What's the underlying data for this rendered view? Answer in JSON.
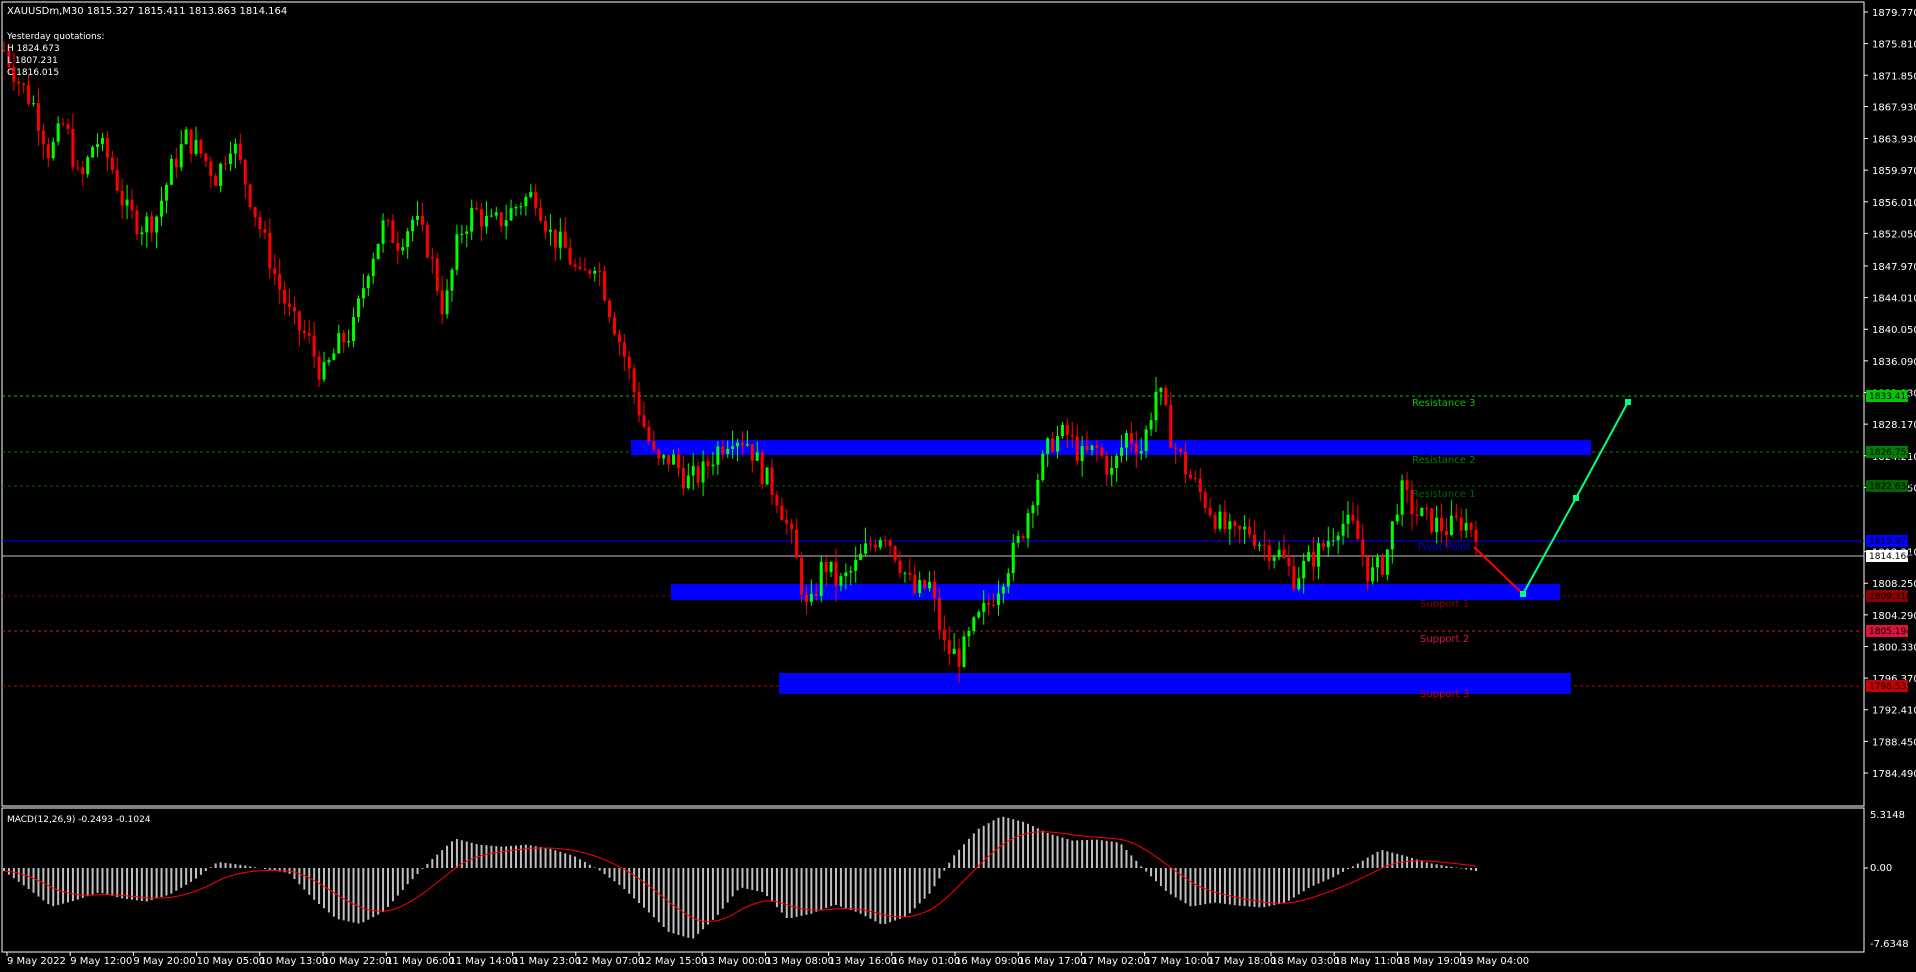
{
  "header": {
    "symbol_line": "XAUUSDm,M30  1815.327 1815.411 1813.863 1814.164",
    "yesterday_title": "Yesterday quotations:",
    "yesterday_high": "H 1824.673",
    "yesterday_low": "L 1807.231",
    "yesterday_close": "C 1816.015"
  },
  "macd": {
    "label": "MACD(12,26,9) -0.2493 -0.1024",
    "axis_top": "5.3148",
    "axis_zero": "0.00",
    "axis_bottom": "-7.6348"
  },
  "price_axis": {
    "ticks": [
      "1879.770",
      "1875.810",
      "1871.850",
      "1867.930",
      "1863.930",
      "1859.970",
      "1856.010",
      "1852.050",
      "1847.970",
      "1844.010",
      "1840.050",
      "1836.090",
      "1832.130",
      "1828.170",
      "1824.210",
      "1820.250",
      "1812.210",
      "1808.250",
      "1804.290",
      "1800.330",
      "1796.370",
      "1792.410",
      "1788.450",
      "1784.490"
    ]
  },
  "time_axis": {
    "labels": [
      "9 May 2022",
      "9 May 12:00",
      "9 May 20:00",
      "10 May 05:00",
      "10 May 13:00",
      "10 May 22:00",
      "11 May 06:00",
      "11 May 14:00",
      "11 May 23:00",
      "12 May 07:00",
      "12 May 15:00",
      "13 May 00:00",
      "13 May 08:00",
      "13 May 16:00",
      "16 May 01:00",
      "16 May 09:00",
      "16 May 17:00",
      "17 May 02:00",
      "17 May 10:00",
      "17 May 18:00",
      "18 May 03:00",
      "18 May 11:00",
      "18 May 19:00",
      "19 May 04:00"
    ]
  },
  "levels": {
    "resistance_3": {
      "label": "Resistance 3",
      "price": "1833.415",
      "color": "#00c800"
    },
    "resistance_2": {
      "label": "Resistance 2",
      "price": "1826.752",
      "color": "#008000"
    },
    "resistance_1": {
      "label": "Resistance 1",
      "price": "1822.636",
      "color": "#006400"
    },
    "pivot": {
      "label": "Pivot Point",
      "price": "1815.973",
      "color": "#0000ff"
    },
    "current": {
      "price": "1814.164"
    },
    "support_1": {
      "label": "Support 1",
      "price": "1809.310",
      "color": "#8b0000"
    },
    "support_2": {
      "label": "Support 2",
      "price": "1805.194",
      "color": "#dc143c"
    },
    "support_3": {
      "label": "Support 3",
      "price": "1798.531",
      "color": "#c80000"
    }
  },
  "colors": {
    "background": "#000000",
    "bull": "#00ff00",
    "bear": "#ff0000",
    "zone": "#0000ff",
    "projection_down": "#ff0000",
    "projection_up": "#00ff7f",
    "macd_hist": "#c0c0c0",
    "macd_signal": "#ff0000"
  },
  "chart_data": {
    "type": "candlestick",
    "symbol": "XAUUSDm",
    "timeframe": "M30",
    "close_path": [
      1875,
      1871,
      1868,
      1862,
      1866,
      1858,
      1864,
      1861,
      1855,
      1853,
      1854,
      1860,
      1864,
      1862,
      1859,
      1864,
      1858,
      1852,
      1846,
      1841,
      1839,
      1834,
      1838,
      1840,
      1848,
      1853,
      1851,
      1854,
      1850,
      1842,
      1852,
      1855,
      1853,
      1854,
      1856,
      1857,
      1852,
      1850,
      1846,
      1849,
      1842,
      1836,
      1829,
      1823,
      1824,
      1821,
      1822,
      1825,
      1827,
      1826,
      1822,
      1819,
      1813,
      1804,
      1811,
      1808,
      1810,
      1813,
      1815,
      1811,
      1807,
      1808,
      1800,
      1799,
      1803,
      1806,
      1810,
      1814,
      1821,
      1826,
      1827,
      1824,
      1825,
      1822,
      1827,
      1825,
      1833,
      1826,
      1822,
      1819,
      1816,
      1814,
      1815,
      1813,
      1812,
      1809,
      1811,
      1813,
      1816,
      1815,
      1809,
      1811,
      1820,
      1817,
      1816,
      1815,
      1816,
      1815
    ],
    "macd_hist_path": [
      -0.3,
      -2.0,
      -3.8,
      -3.2,
      -2.4,
      -3.0,
      -3.3,
      -2.6,
      -1.2,
      0.6,
      0.3,
      -0.1,
      -0.5,
      -3.0,
      -5.0,
      -5.5,
      -4.3,
      -1.6,
      0.8,
      2.9,
      2.3,
      2.1,
      2.3,
      1.9,
      1.2,
      -0.1,
      -1.8,
      -4.0,
      -6.3,
      -7.0,
      -4.8,
      -1.9,
      -2.4,
      -5.0,
      -4.5,
      -3.6,
      -4.4,
      -5.6,
      -4.8,
      -2.5,
      1.2,
      3.8,
      5.1,
      4.5,
      3.4,
      2.7,
      2.8,
      2.5,
      -0.1,
      -2.4,
      -3.8,
      -3.4,
      -3.7,
      -3.9,
      -3.4,
      -1.9,
      -0.9,
      0.4,
      1.8,
      1.2,
      0.5,
      0.1,
      -0.3
    ]
  }
}
